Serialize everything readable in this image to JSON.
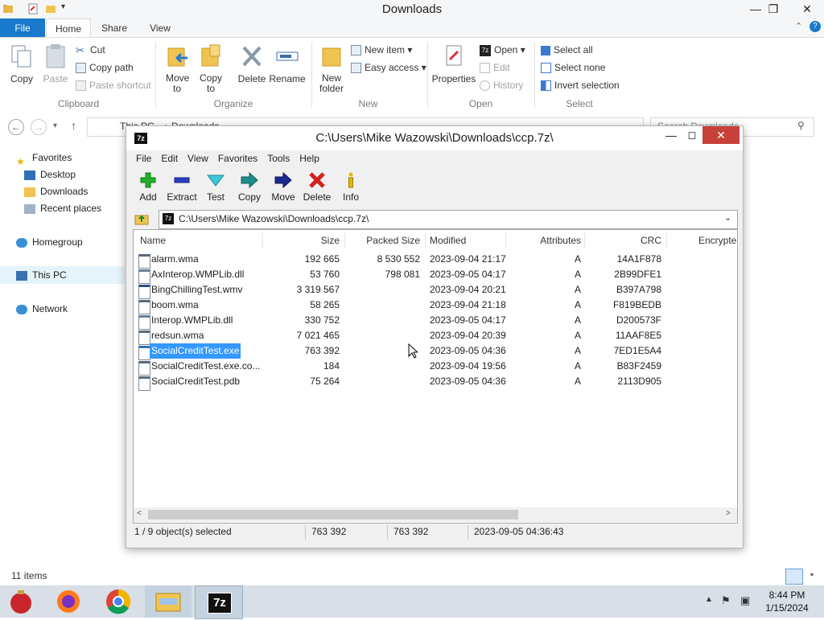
{
  "explorer": {
    "title": "Downloads",
    "tabs": {
      "file": "File",
      "home": "Home",
      "share": "Share",
      "view": "View"
    },
    "ribbon": {
      "clipboard": {
        "copy": "Copy",
        "paste": "Paste",
        "cut": "Cut",
        "copy_path": "Copy path",
        "paste_shortcut": "Paste shortcut",
        "group": "Clipboard"
      },
      "organize": {
        "move_to": "Move to",
        "copy_to": "Copy to",
        "delete": "Delete",
        "rename": "Rename",
        "group": "Organize"
      },
      "new": {
        "new_folder_line1": "New",
        "new_folder_line2": "folder",
        "new_item": "New item",
        "easy_access": "Easy access",
        "group": "New"
      },
      "open": {
        "properties": "Properties",
        "open": "Open",
        "edit": "Edit",
        "history": "History",
        "group": "Open"
      },
      "select": {
        "select_all": "Select all",
        "select_none": "Select none",
        "invert_selection": "Invert selection",
        "group": "Select"
      }
    },
    "address": {
      "path_part1": "This PC",
      "path_part2": "Downloads",
      "search_placeholder": "Search Downloads"
    },
    "nav": {
      "favorites": "Favorites",
      "desktop": "Desktop",
      "downloads": "Downloads",
      "recent_places": "Recent places",
      "homegroup": "Homegroup",
      "this_pc": "This PC",
      "network": "Network"
    },
    "status": "11 items"
  },
  "sevenzip": {
    "title": "C:\\Users\\Mike Wazowski\\Downloads\\ccp.7z\\",
    "menu": [
      "File",
      "Edit",
      "View",
      "Favorites",
      "Tools",
      "Help"
    ],
    "toolbar": {
      "add": "Add",
      "extract": "Extract",
      "test": "Test",
      "copy": "Copy",
      "move": "Move",
      "delete": "Delete",
      "info": "Info"
    },
    "address": "C:\\Users\\Mike Wazowski\\Downloads\\ccp.7z\\",
    "columns": {
      "name": "Name",
      "size": "Size",
      "packed": "Packed Size",
      "modified": "Modified",
      "attributes": "Attributes",
      "crc": "CRC",
      "encrypted": "Encrypte"
    },
    "files": [
      {
        "name": "alarm.wma",
        "size": "192 665",
        "packed": "8 530 552",
        "modified": "2023-09-04 21:17",
        "attr": "A",
        "crc": "14A1F878"
      },
      {
        "name": "AxInterop.WMPLib.dll",
        "size": "53 760",
        "packed": "798 081",
        "modified": "2023-09-05 04:17",
        "attr": "A",
        "crc": "2B99DFE1"
      },
      {
        "name": "BingChillingTest.wmv",
        "size": "3 319 567",
        "packed": "",
        "modified": "2023-09-04 20:21",
        "attr": "A",
        "crc": "B397A798"
      },
      {
        "name": "boom.wma",
        "size": "58 265",
        "packed": "",
        "modified": "2023-09-04 21:18",
        "attr": "A",
        "crc": "F819BEDB"
      },
      {
        "name": "Interop.WMPLib.dll",
        "size": "330 752",
        "packed": "",
        "modified": "2023-09-05 04:17",
        "attr": "A",
        "crc": "D200573F"
      },
      {
        "name": "redsun.wma",
        "size": "7 021 465",
        "packed": "",
        "modified": "2023-09-04 20:39",
        "attr": "A",
        "crc": "11AAF8E5"
      },
      {
        "name": "SocialCreditTest.exe",
        "size": "763 392",
        "packed": "",
        "modified": "2023-09-05 04:36",
        "attr": "A",
        "crc": "7ED1E5A4"
      },
      {
        "name": "SocialCreditTest.exe.co...",
        "size": "184",
        "packed": "",
        "modified": "2023-09-04 19:56",
        "attr": "A",
        "crc": "B83F2459"
      },
      {
        "name": "SocialCreditTest.pdb",
        "size": "75 264",
        "packed": "",
        "modified": "2023-09-05 04:36",
        "attr": "A",
        "crc": "2113D905"
      }
    ],
    "status": {
      "selected": "1 / 9 object(s) selected",
      "size": "763 392",
      "packed": "763 392",
      "modified": "2023-09-05 04:36:43"
    }
  },
  "taskbar": {
    "time": "8:44 PM",
    "date": "1/15/2024",
    "sevenzip_label": "7z"
  }
}
